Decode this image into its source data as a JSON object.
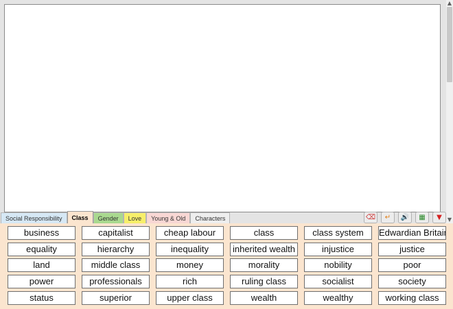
{
  "tabs": [
    {
      "label": "Social Responsibility",
      "color": "#d6e8f5",
      "active": false
    },
    {
      "label": "Class",
      "color": "#fbe5cf",
      "active": true
    },
    {
      "label": "Gender",
      "color": "#a9d98f",
      "active": false
    },
    {
      "label": "Love",
      "color": "#f7ef6a",
      "active": false
    },
    {
      "label": "Young & Old",
      "color": "#f8d7d4",
      "active": false
    },
    {
      "label": "Characters",
      "color": "#eeeeee",
      "active": false
    }
  ],
  "tools": [
    {
      "name": "backspace-icon",
      "glyph": "⌫",
      "color": "#cc3333"
    },
    {
      "name": "enter-icon",
      "glyph": "↵",
      "color": "#e07b10"
    },
    {
      "name": "speak-icon",
      "glyph": "🔊",
      "color": "#3a7cc7"
    },
    {
      "name": "keyboard-icon",
      "glyph": "▦",
      "color": "#2e8b2e"
    },
    {
      "name": "collapse-icon",
      "glyph": "▼",
      "color": "#d42020"
    }
  ],
  "words": [
    "business",
    "capitalist",
    "cheap labour",
    "class",
    "class system",
    "Edwardian Britain",
    "equality",
    "hierarchy",
    "inequality",
    "inherited wealth",
    "injustice",
    "justice",
    "land",
    "middle class",
    "money",
    "morality",
    "nobility",
    "poor",
    "power",
    "professionals",
    "rich",
    "ruling class",
    "socialist",
    "society",
    "status",
    "superior",
    "upper class",
    "wealth",
    "wealthy",
    "working class"
  ]
}
